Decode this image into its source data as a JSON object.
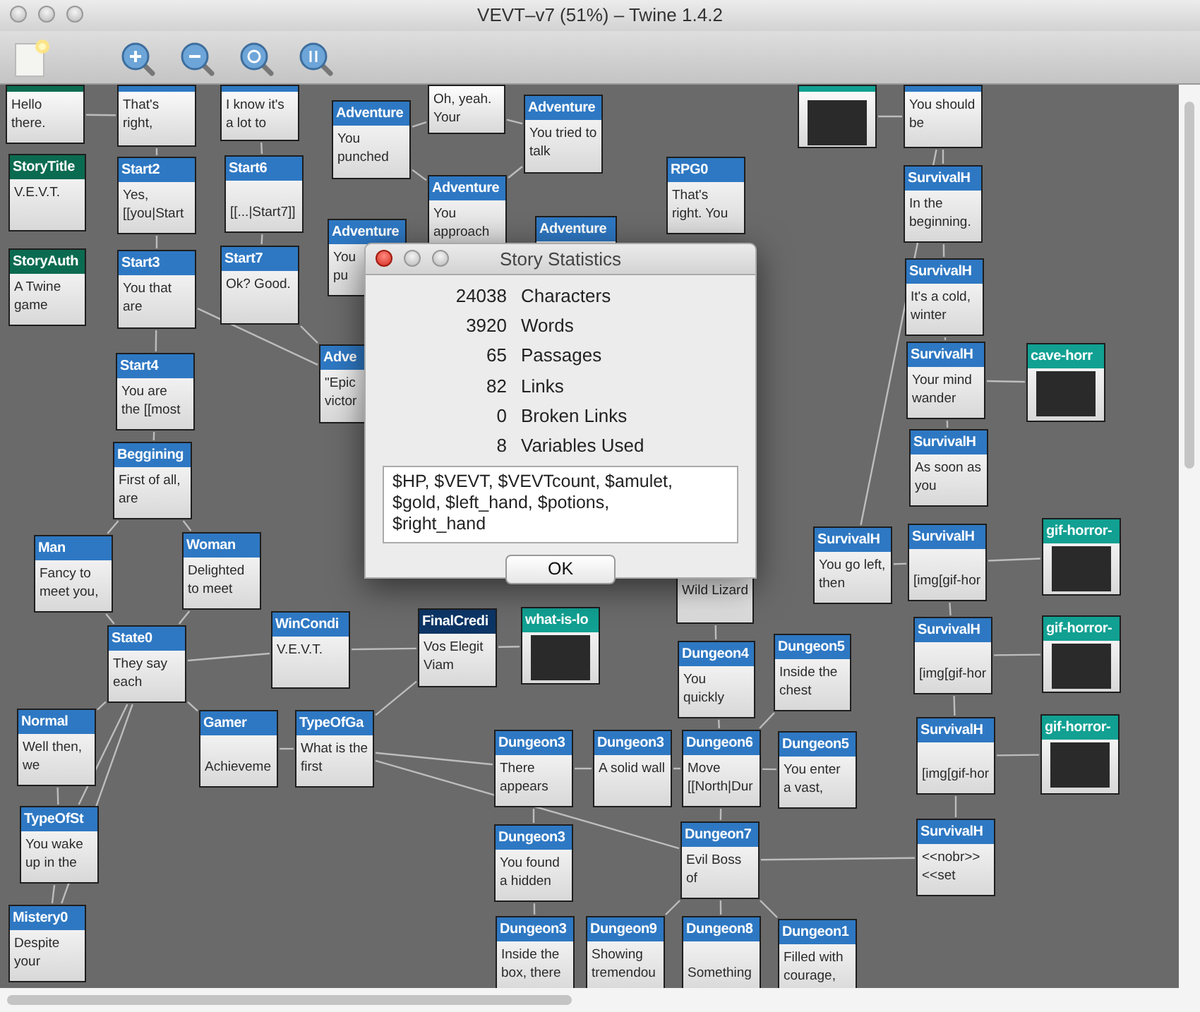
{
  "window": {
    "title": "VEVT–v7 (51%) – Twine 1.4.2"
  },
  "passages": [
    {
      "kind": "text",
      "text": "Hello there.",
      "color": "#0b6b50"
    },
    {
      "kind": "text",
      "text": "That's right,",
      "color": "#2e78c3"
    },
    {
      "kind": "text",
      "text": "I know it's a lot to",
      "color": "#2e78c3"
    },
    {
      "kind": "text",
      "title": "Adventure",
      "text": "You punched",
      "color": "#2e78c3"
    },
    {
      "kind": "text",
      "text": "Oh, yeah. Your"
    },
    {
      "kind": "text",
      "title": "Adventure",
      "text": "You tried to talk",
      "color": "#2e78c3"
    },
    {
      "kind": "image",
      "color": "#11a092"
    },
    {
      "kind": "text",
      "text": "You should be",
      "color": "#2e78c3"
    },
    {
      "kind": "text",
      "title": "StoryTitle",
      "text": "V.E.V.T.",
      "color": "#0b6b50"
    },
    {
      "kind": "text",
      "title": "Start2",
      "text": "Yes, [[you|Start",
      "color": "#2e78c3"
    },
    {
      "kind": "text",
      "title": "Start6",
      "text": "\n[[...|Start7]]",
      "color": "#2e78c3"
    },
    {
      "kind": "text",
      "title": "Adventure",
      "text": "You approach",
      "color": "#2e78c3"
    },
    {
      "kind": "text",
      "title": "RPG0",
      "text": "That's right. You",
      "color": "#2e78c3"
    },
    {
      "kind": "text",
      "title": "SurvivalH",
      "text": "In the beginning.",
      "color": "#2e78c3"
    },
    {
      "kind": "text",
      "title": "Adventure",
      "text": "You\npu",
      "color": "#2e78c3"
    },
    {
      "kind": "text",
      "title": "Adventure",
      "color": "#2e78c3"
    },
    {
      "kind": "text",
      "title": "StoryAuth",
      "text": "A Twine game",
      "color": "#0b6b50"
    },
    {
      "kind": "text",
      "title": "Start3",
      "text": "You that are",
      "color": "#2e78c3"
    },
    {
      "kind": "text",
      "title": "Start7",
      "text": "Ok? Good.",
      "color": "#2e78c3"
    },
    {
      "kind": "text",
      "title": "SurvivalH",
      "text": "It's a cold, winter",
      "color": "#2e78c3"
    },
    {
      "kind": "text",
      "title": "Start4",
      "text": "You are the [[most",
      "color": "#2e78c3"
    },
    {
      "kind": "text",
      "title": "Adve",
      "text": "\"Epic\nvictor",
      "color": "#2e78c3"
    },
    {
      "kind": "text",
      "title": "SurvivalH",
      "text": "Your mind wander",
      "color": "#2e78c3"
    },
    {
      "kind": "image",
      "title": "cave-horr",
      "color": "#11a092"
    },
    {
      "kind": "text",
      "title": "SurvivalH",
      "text": "As soon as you",
      "color": "#2e78c3"
    },
    {
      "kind": "text",
      "title": "Beggining",
      "text": "First of all, are",
      "color": "#2e78c3"
    },
    {
      "kind": "text",
      "title": "Man",
      "text": "Fancy to meet you,",
      "color": "#2e78c3"
    },
    {
      "kind": "text",
      "title": "Woman",
      "text": "Delighted to meet",
      "color": "#2e78c3"
    },
    {
      "kind": "text",
      "title": "SurvivalH",
      "text": "You go left, then",
      "color": "#2e78c3"
    },
    {
      "kind": "text",
      "title": "SurvivalH",
      "text": "\n[img[gif-hor",
      "color": "#2e78c3"
    },
    {
      "kind": "image",
      "title": "gif-horror-",
      "color": "#11a092"
    },
    {
      "kind": "text",
      "text": "\nWild Lizard"
    },
    {
      "kind": "text",
      "title": "WinCondi",
      "text": "V.E.V.T.",
      "color": "#2e78c3"
    },
    {
      "kind": "text",
      "title": "FinalCredi",
      "text": "Vos Elegit Viam",
      "color": "#0c3566"
    },
    {
      "kind": "image",
      "title": "what-is-lo",
      "color": "#11a092"
    },
    {
      "kind": "text",
      "title": "State0",
      "text": "They say each",
      "color": "#2e78c3"
    },
    {
      "kind": "text",
      "title": "Dungeon4",
      "text": "You quickly",
      "color": "#2e78c3"
    },
    {
      "kind": "text",
      "title": "Dungeon5",
      "text": "Inside the chest",
      "color": "#2e78c3"
    },
    {
      "kind": "text",
      "title": "SurvivalH",
      "text": "\n[img[gif-hor",
      "color": "#2e78c3"
    },
    {
      "kind": "image",
      "title": "gif-horror-",
      "color": "#11a092"
    },
    {
      "kind": "text",
      "title": "Normal",
      "text": "Well then, we",
      "color": "#2e78c3"
    },
    {
      "kind": "text",
      "title": "Gamer",
      "text": "\nAchieveme",
      "color": "#2e78c3"
    },
    {
      "kind": "text",
      "title": "TypeOfGa",
      "text": "What is the first",
      "color": "#2e78c3"
    },
    {
      "kind": "text",
      "title": "Dungeon3",
      "text": "There appears",
      "color": "#2e78c3"
    },
    {
      "kind": "text",
      "title": "Dungeon3",
      "text": "A solid wall",
      "color": "#2e78c3"
    },
    {
      "kind": "text",
      "title": "Dungeon6",
      "text": "Move [[North|Dur",
      "color": "#2e78c3"
    },
    {
      "kind": "text",
      "title": "Dungeon5",
      "text": "You enter a vast,",
      "color": "#2e78c3"
    },
    {
      "kind": "text",
      "title": "SurvivalH",
      "text": "\n[img[gif-hor",
      "color": "#2e78c3"
    },
    {
      "kind": "image",
      "title": "gif-horror-",
      "color": "#11a092"
    },
    {
      "kind": "text",
      "title": "TypeOfSt",
      "text": "You wake up in the",
      "color": "#2e78c3"
    },
    {
      "kind": "text",
      "title": "Dungeon3",
      "text": "You found a hidden",
      "color": "#2e78c3"
    },
    {
      "kind": "text",
      "title": "Dungeon7",
      "text": "Evil Boss of",
      "color": "#2e78c3"
    },
    {
      "kind": "text",
      "title": "SurvivalH",
      "text": "<<nobr>> <<set",
      "color": "#2e78c3"
    },
    {
      "kind": "text",
      "title": "Mistery0",
      "text": "Despite your",
      "color": "#2e78c3"
    },
    {
      "kind": "text",
      "title": "Dungeon3",
      "text": "Inside the box, there",
      "color": "#2e78c3"
    },
    {
      "kind": "text",
      "title": "Dungeon9",
      "text": "Showing tremendou",
      "color": "#2e78c3"
    },
    {
      "kind": "text",
      "title": "Dungeon8",
      "text": "\nSomething",
      "color": "#2e78c3"
    },
    {
      "kind": "text",
      "title": "Dungeon1",
      "text": "Filled with courage,",
      "color": "#2e78c3"
    }
  ],
  "dialog": {
    "title": "Story Statistics",
    "stats": [
      {
        "number": "24038",
        "name": "Characters"
      },
      {
        "number": "3920",
        "name": "Words"
      },
      {
        "number": "65",
        "name": "Passages"
      },
      {
        "number": "82",
        "name": "Links"
      },
      {
        "number": "0",
        "name": "Broken Links"
      },
      {
        "number": "8",
        "name": "Variables Used"
      }
    ],
    "variables": "$HP, $VEVT, $VEVTcount, $amulet, $gold, $left_hand, $potions, $right_hand",
    "button": "OK"
  }
}
